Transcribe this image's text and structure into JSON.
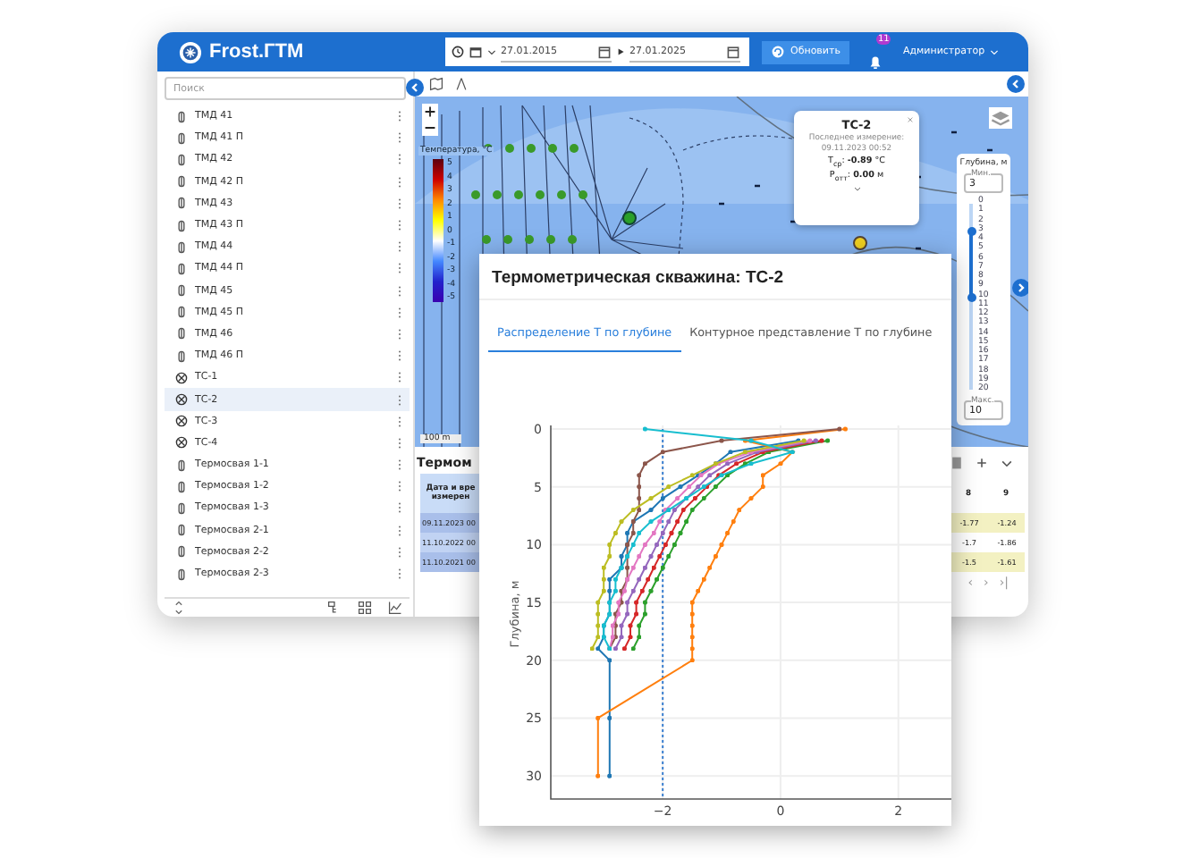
{
  "header": {
    "title": "Frost.ГТМ",
    "date_from": "27.01.2015",
    "date_to": "27.01.2025",
    "refresh_button": "Обновить",
    "notifications": "11",
    "user": "Администратор"
  },
  "sidebar": {
    "search": {
      "placeholder": "Поиск"
    },
    "items": [
      {
        "label": "ТМД 41",
        "kind": "sensor",
        "selected": false
      },
      {
        "label": "ТМД 41 П",
        "kind": "sensor",
        "selected": false
      },
      {
        "label": "ТМД 42",
        "kind": "sensor",
        "selected": false
      },
      {
        "label": "ТМД 42 П",
        "kind": "sensor",
        "selected": false
      },
      {
        "label": "ТМД 43",
        "kind": "sensor",
        "selected": false
      },
      {
        "label": "ТМД 43 П",
        "kind": "sensor",
        "selected": false
      },
      {
        "label": "ТМД 44",
        "kind": "sensor",
        "selected": false
      },
      {
        "label": "ТМД 44 П",
        "kind": "sensor",
        "selected": false
      },
      {
        "label": "ТМД 45",
        "kind": "sensor",
        "selected": false
      },
      {
        "label": "ТМД 45 П",
        "kind": "sensor",
        "selected": false
      },
      {
        "label": "ТМД 46",
        "kind": "sensor",
        "selected": false
      },
      {
        "label": "ТМД 46 П",
        "kind": "sensor",
        "selected": false
      },
      {
        "label": "ТС-1",
        "kind": "well",
        "selected": false
      },
      {
        "label": "ТС-2",
        "kind": "well",
        "selected": true
      },
      {
        "label": "ТС-3",
        "kind": "well",
        "selected": false
      },
      {
        "label": "ТС-4",
        "kind": "well",
        "selected": false
      },
      {
        "label": "Термосвая 1-1",
        "kind": "sensor",
        "selected": false
      },
      {
        "label": "Термосвая 1-2",
        "kind": "sensor",
        "selected": false
      },
      {
        "label": "Термосвая 1-3",
        "kind": "sensor",
        "selected": false
      },
      {
        "label": "Термосвая 2-1",
        "kind": "sensor",
        "selected": false
      },
      {
        "label": "Термосвая 2-2",
        "kind": "sensor",
        "selected": false
      },
      {
        "label": "Термосвая 2-3",
        "kind": "sensor",
        "selected": false
      }
    ]
  },
  "map": {
    "legend": {
      "title": "Температура, °С",
      "ticks": [
        "5",
        "4",
        "3",
        "2",
        "1",
        "0",
        "-1",
        "-2",
        "-3",
        "-4",
        "-5"
      ]
    },
    "scale": "100 m",
    "popup": {
      "title": "ТС-2",
      "caption": "Последнее измерение:",
      "time": "09.11.2023 00:52",
      "temperature": "T$_{ср}$: **-0.89** °C",
      "depth": "P$_{отт}$: **0.00** м"
    },
    "depth_filter": {
      "title": "Глубина, м",
      "min_label": "Мин.",
      "min": "3",
      "max_label": "Макс.",
      "max": "10",
      "ticks": [
        "0",
        "1",
        "2",
        "3",
        "4",
        "5",
        "6",
        "7",
        "8",
        "9",
        "10",
        "11",
        "12",
        "13",
        "14",
        "15",
        "16",
        "17",
        "18",
        "19",
        "20"
      ],
      "thumbs": [
        {
          "level": 0.15
        },
        {
          "level": 0.5
        }
      ]
    }
  },
  "table": {
    "title": "Термом",
    "header": "Дата и вре\nизмерен",
    "rows": [
      "09.11.2023 00",
      "11.10.2022 00",
      "11.10.2021 00"
    ],
    "columns": [
      "8",
      "9"
    ],
    "cells": [
      [
        "-1.77",
        "-1.24"
      ],
      [
        "-1.7",
        "-1.86"
      ],
      [
        "-1.5",
        "-1.61"
      ]
    ],
    "pager": [
      "‹",
      "›",
      "›|"
    ]
  },
  "dialog": {
    "title": "Термометрическая скважина: ТС-2",
    "tabs": [
      {
        "label": "Распределение Т по глубине",
        "selected": true
      },
      {
        "label": "Контурное представление Т по глубине",
        "selected": false
      }
    ],
    "chart_data": {
      "type": "line",
      "ylabel": "Глубина, м",
      "xlim": [
        -3.9,
        2.9
      ],
      "xticks": [
        {
          "value": -2,
          "label": "−2"
        },
        0,
        2
      ],
      "ylim": [
        32,
        0
      ],
      "grid": true,
      "yticks": [
        0,
        5,
        10,
        15,
        20,
        25,
        30
      ],
      "ref_lines": [
        {
          "axis": "x",
          "value": -2
        }
      ],
      "series": [
        {
          "color": "#1f77b4",
          "x": [
            0.3,
            -0.85,
            -1.1,
            -1.4,
            -1.7,
            -2.0,
            -2.2,
            -2.5,
            -2.6,
            -2.6,
            -2.7,
            -2.7,
            -2.9,
            -2.9,
            -2.9,
            -2.9,
            -3.0,
            -3.0,
            -3.1,
            -2.9,
            -2.9,
            -2.9
          ],
          "values": [
            1,
            2,
            3,
            4,
            5,
            6,
            7,
            8,
            9,
            10,
            11,
            12,
            13,
            14,
            15,
            16,
            17,
            18,
            19,
            20,
            25,
            30
          ]
        },
        {
          "color": "#ff7f0e",
          "x": [
            1.1,
            -0.6,
            0.2,
            0.0,
            -0.3,
            -0.3,
            -0.5,
            -0.7,
            -0.8,
            -0.9,
            -1.0,
            -1.1,
            -1.2,
            -1.3,
            -1.4,
            -1.5,
            -1.5,
            -1.5,
            -1.5,
            -1.5,
            -1.5,
            -3.1,
            -3.1
          ],
          "values": [
            0,
            1,
            2,
            3,
            4,
            5,
            6,
            7,
            8,
            9,
            10,
            11,
            12,
            13,
            14,
            15,
            16,
            17,
            18,
            19,
            20,
            25,
            30
          ]
        },
        {
          "color": "#2ca02c",
          "x": [
            0.8,
            -0.2,
            -0.6,
            -0.9,
            -1.1,
            -1.3,
            -1.5,
            -1.6,
            -1.7,
            -1.8,
            -1.9,
            -2.0,
            -2.1,
            -2.2,
            -2.3,
            -2.3,
            -2.4,
            -2.4,
            -2.5
          ],
          "values": [
            1,
            2,
            3,
            4,
            5,
            6,
            7,
            8,
            9,
            10,
            11,
            12,
            13,
            14,
            15,
            16,
            17,
            18,
            19
          ]
        },
        {
          "color": "#d62728",
          "x": [
            0.7,
            -0.3,
            -0.75,
            -1.05,
            -1.25,
            -1.45,
            -1.65,
            -1.75,
            -1.85,
            -1.95,
            -2.05,
            -2.15,
            -2.25,
            -2.35,
            -2.45,
            -2.45,
            -2.55,
            -2.55,
            -2.65
          ],
          "values": [
            1,
            2,
            3,
            4,
            5,
            6,
            7,
            8,
            9,
            10,
            11,
            12,
            13,
            14,
            15,
            16,
            17,
            18,
            19
          ]
        },
        {
          "color": "#9467bd",
          "x": [
            0.6,
            -0.4,
            -0.9,
            -1.2,
            -1.4,
            -1.6,
            -1.8,
            -1.9,
            -2.0,
            -2.1,
            -2.2,
            -2.3,
            -2.4,
            -2.5,
            -2.6,
            -2.6,
            -2.7,
            -2.7,
            -2.8
          ],
          "values": [
            1,
            2,
            3,
            4,
            5,
            6,
            7,
            8,
            9,
            10,
            11,
            12,
            13,
            14,
            15,
            16,
            17,
            18,
            19
          ]
        },
        {
          "color": "#8c564b",
          "x": [
            1.0,
            -1.0,
            -2.0,
            -2.3,
            -2.4,
            -2.4,
            -2.4,
            -2.4,
            -2.5,
            -2.5,
            -2.6,
            -2.6,
            -2.6,
            -2.6,
            -2.7,
            -2.7,
            -2.8,
            -2.8,
            -2.8,
            -2.9
          ],
          "values": [
            0,
            1,
            2,
            3,
            4,
            5,
            6,
            7,
            8,
            9,
            10,
            11,
            12,
            13,
            14,
            15,
            16,
            17,
            18,
            19
          ]
        },
        {
          "color": "#e377c2",
          "x": [
            0.5,
            -0.5,
            -1.05,
            -1.35,
            -1.55,
            -1.75,
            -1.95,
            -2.05,
            -2.15,
            -2.3,
            -2.4,
            -2.5,
            -2.6,
            -2.65,
            -2.75,
            -2.75,
            -2.85,
            -2.85,
            -2.9
          ],
          "values": [
            1,
            2,
            3,
            4,
            5,
            6,
            7,
            8,
            9,
            10,
            11,
            12,
            13,
            14,
            15,
            16,
            17,
            18,
            19
          ]
        },
        {
          "color": "#bcbd22",
          "x": [
            0.4,
            -0.6,
            -1.1,
            -1.5,
            -1.9,
            -2.2,
            -2.5,
            -2.7,
            -2.8,
            -2.9,
            -2.9,
            -3.0,
            -3.0,
            -3.0,
            -3.1,
            -3.1,
            -3.1,
            -3.1,
            -3.2
          ],
          "values": [
            1,
            2,
            3,
            4,
            5,
            6,
            7,
            8,
            9,
            10,
            11,
            12,
            13,
            14,
            15,
            16,
            17,
            18,
            19
          ]
        },
        {
          "color": "#17becf",
          "x": [
            -2.3,
            -0.5,
            0.2,
            -0.5,
            -1.0,
            -1.3,
            -1.6,
            -1.9,
            -2.2,
            -2.4,
            -2.5,
            -2.6,
            -2.7,
            -2.8,
            -2.8,
            -2.9,
            -2.9,
            -3.0,
            -3.0,
            -2.9
          ],
          "values": [
            0,
            1,
            2,
            3,
            4,
            5,
            6,
            7,
            8,
            9,
            10,
            11,
            12,
            13,
            14,
            15,
            16,
            17,
            18,
            19
          ]
        }
      ]
    }
  }
}
